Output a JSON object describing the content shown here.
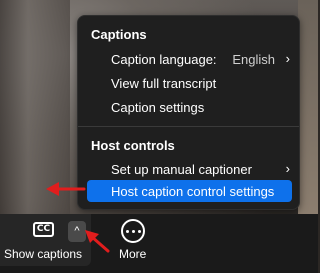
{
  "menu": {
    "captions_header": "Captions",
    "caption_language_label": "Caption language:",
    "caption_language_value": "English",
    "view_full_transcript": "View full transcript",
    "caption_settings": "Caption settings",
    "host_controls_header": "Host controls",
    "set_up_manual_captioner": "Set up manual captioner",
    "host_caption_control_settings": "Host caption control settings"
  },
  "toolbar": {
    "cc_icon_text": "CC",
    "show_captions_label": "Show captions",
    "more_label": "More"
  },
  "icons": {
    "chevron_right": "›",
    "caret_up": "^"
  },
  "colors": {
    "highlight": "#0e71eb",
    "menu_bg": "#1f1f1f",
    "annotation_arrow": "#e11d1d"
  }
}
